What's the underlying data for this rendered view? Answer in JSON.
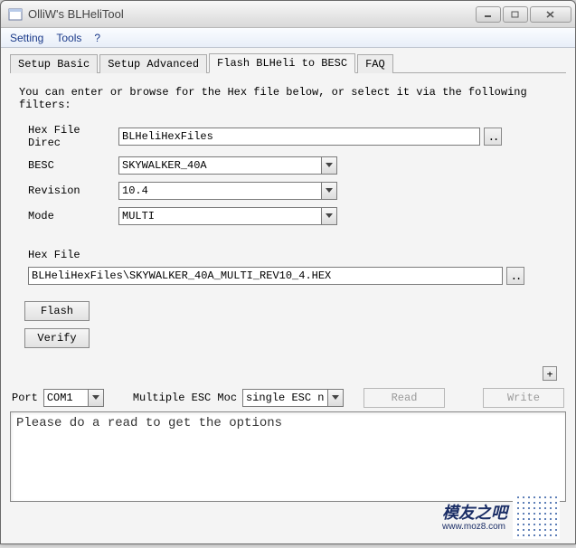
{
  "window": {
    "title": "OlliW's BLHeliTool"
  },
  "menu": {
    "setting": "Setting",
    "tools": "Tools",
    "help": "?"
  },
  "tabs": {
    "basic": "Setup Basic",
    "advanced": "Setup Advanced",
    "flash": "Flash BLHeli to BESC",
    "faq": "FAQ"
  },
  "flash": {
    "intro": "You can enter or browse for the Hex file below, or select it via the following filters:",
    "hex_dir_label": "Hex File Direc",
    "hex_dir_value": "BLHeliHexFiles",
    "besc_label": "BESC",
    "besc_value": "SKYWALKER_40A",
    "rev_label": "Revision",
    "rev_value": "10.4",
    "mode_label": "Mode",
    "mode_value": "MULTI",
    "hex_file_label": "Hex File",
    "hex_file_value": "BLHeliHexFiles\\SKYWALKER_40A_MULTI_REV10_4.HEX",
    "flash_btn": "Flash",
    "verify_btn": "Verify",
    "browse_glyph": "..",
    "expand_glyph": "+"
  },
  "bottom": {
    "port_label": "Port",
    "port_value": "COM1",
    "multi_label": "Multiple ESC Moc",
    "multi_value": "single ESC no.",
    "read_btn": "Read",
    "write_btn": "Write"
  },
  "log": {
    "text": "Please do a read to get the options"
  },
  "watermark": {
    "name": "模友之吧",
    "url": "www.moz8.com"
  }
}
